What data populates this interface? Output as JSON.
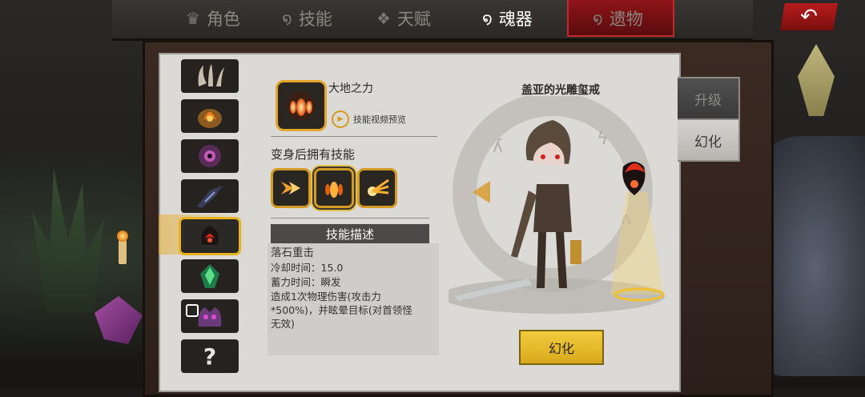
{
  "tabs": [
    {
      "label": "角色",
      "icon": "crown-icon",
      "active": false
    },
    {
      "label": "技能",
      "icon": "swirl-icon",
      "active": false
    },
    {
      "label": "天赋",
      "icon": "gem-icon",
      "active": false
    },
    {
      "label": "魂器",
      "icon": "soul-swirl-icon",
      "active": true
    },
    {
      "label": "遗物",
      "icon": "relic-icon",
      "active": false
    }
  ],
  "back_glyph": "↶",
  "side_tabs": {
    "upgrade": "升级",
    "transform": "幻化"
  },
  "items": [
    {
      "name": "claw-relic",
      "selected": false,
      "locked": false
    },
    {
      "name": "fire-helm-relic",
      "selected": false,
      "locked": false
    },
    {
      "name": "eye-orb-relic",
      "selected": false,
      "locked": false
    },
    {
      "name": "dark-blade-relic",
      "selected": false,
      "locked": false
    },
    {
      "name": "red-hood-relic",
      "selected": true,
      "locked": false
    },
    {
      "name": "green-crystal-relic",
      "selected": false,
      "locked": false
    },
    {
      "name": "purple-beast-relic",
      "selected": false,
      "locked": true
    },
    {
      "name": "unknown-relic",
      "selected": false,
      "locked": false,
      "glyph": "?"
    }
  ],
  "skill": {
    "name": "大地之力",
    "preview_label": "技能视频预览",
    "section_title": "变身后拥有技能",
    "desc_header": "技能描述",
    "desc_title": "落石重击",
    "cooldown": "冷却时间：15.0",
    "charge": "蓄力时间：瞬发",
    "effect_line1": "造成1次物理伤害(攻击力",
    "effect_line2": "*500%)，并眩晕目标(对首领怪",
    "effect_line3": "无效)"
  },
  "skin_name": "盖亚的光雕玺戒",
  "confirm_label": "幻化"
}
